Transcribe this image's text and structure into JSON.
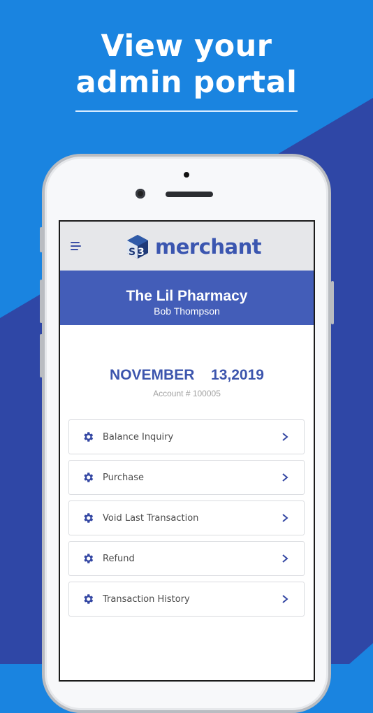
{
  "promo": {
    "headline_line1": "View your",
    "headline_line2": "admin portal",
    "colors": {
      "background": "#1a84e0",
      "diagonal": "#2f47a6"
    }
  },
  "app": {
    "brand_name": "merchant",
    "logo_icon": "s3-cube-logo-icon",
    "menu_icon": "hamburger-menu-icon",
    "accent_color": "#435db8"
  },
  "banner": {
    "store_name": "The Lil Pharmacy",
    "owner_name": "Bob Thompson"
  },
  "summary": {
    "date": "NOVEMBER  13,2019",
    "account": "Account # 100005"
  },
  "menu": {
    "items": [
      {
        "label": "Balance Inquiry",
        "icon": "gear-icon"
      },
      {
        "label": "Purchase",
        "icon": "gear-icon"
      },
      {
        "label": "Void Last Transaction",
        "icon": "gear-icon"
      },
      {
        "label": "Refund",
        "icon": "gear-icon"
      },
      {
        "label": "Transaction History",
        "icon": "gear-icon"
      }
    ]
  }
}
